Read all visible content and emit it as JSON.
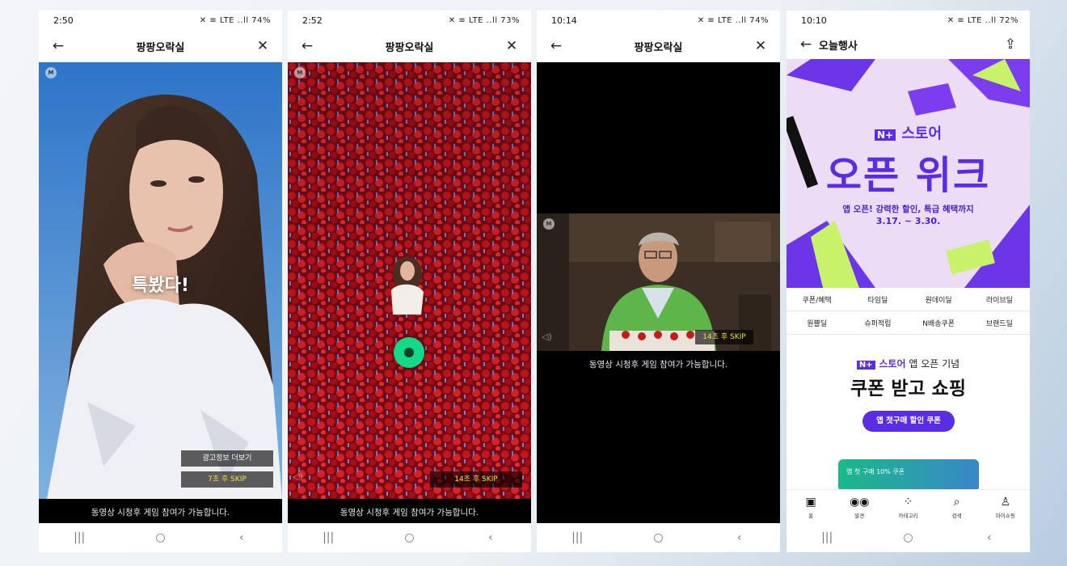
{
  "phones": [
    {
      "time": "2:50",
      "status_icons": "✕ ≡ LTE ..ll 74%",
      "title": "팡팡오락실",
      "video_overlay_text": "특봤다!",
      "ad_info_button": "광고정보 더보기",
      "skip_label": "7초 후 SKIP",
      "caption": "동영상 시청후 게임 참여가 가능합니다."
    },
    {
      "time": "2:52",
      "status_icons": "✕ ≡ LTE ..ll 73%",
      "title": "팡팡오락실",
      "skip_label": "14초 후 SKIP",
      "caption": "동영상 시청후 게임 참여가 가능합니다."
    },
    {
      "time": "10:14",
      "status_icons": "✕ ≡ LTE ..ll 74%",
      "title": "팡팡오락실",
      "skip_label": "14초 후 SKIP",
      "caption": "동영상 시청후 게임 참여가 가능합니다."
    },
    {
      "time": "10:10",
      "status_icons": "✕ ≡ LTE ..ll 72%",
      "title": "오늘행사",
      "banner": {
        "logo": "N+",
        "store": "스토어",
        "headline": "오픈 위크",
        "subline": "앱 오픈! 강력한 할인, 특급 혜택까지",
        "dates": "3.17. ~ 3.30."
      },
      "categories": [
        "쿠폰/혜택",
        "타임딜",
        "원데이딜",
        "라이브딜",
        "원쁠딜",
        "슈퍼적립",
        "N배송쿠폰",
        "브랜드딜"
      ],
      "promo": {
        "line1": "스토어",
        "line1_suffix": "앱 오픈 기념",
        "headline": "쿠폰 받고 쇼핑",
        "button": "앱 첫구매 할인 쿠폰",
        "card_text": "앱 첫 구매 10% 쿠폰"
      },
      "tabs": [
        {
          "label": "홈",
          "icon": "home-icon"
        },
        {
          "label": "발견",
          "icon": "discover-icon"
        },
        {
          "label": "카테고리",
          "icon": "category-icon"
        },
        {
          "label": "검색",
          "icon": "search-icon"
        },
        {
          "label": "마이쇼핑",
          "icon": "profile-icon"
        }
      ]
    }
  ],
  "colors": {
    "brand_purple": "#5a2de3",
    "brand_green": "#03c75a",
    "skip_yellow": "#f3e233"
  }
}
